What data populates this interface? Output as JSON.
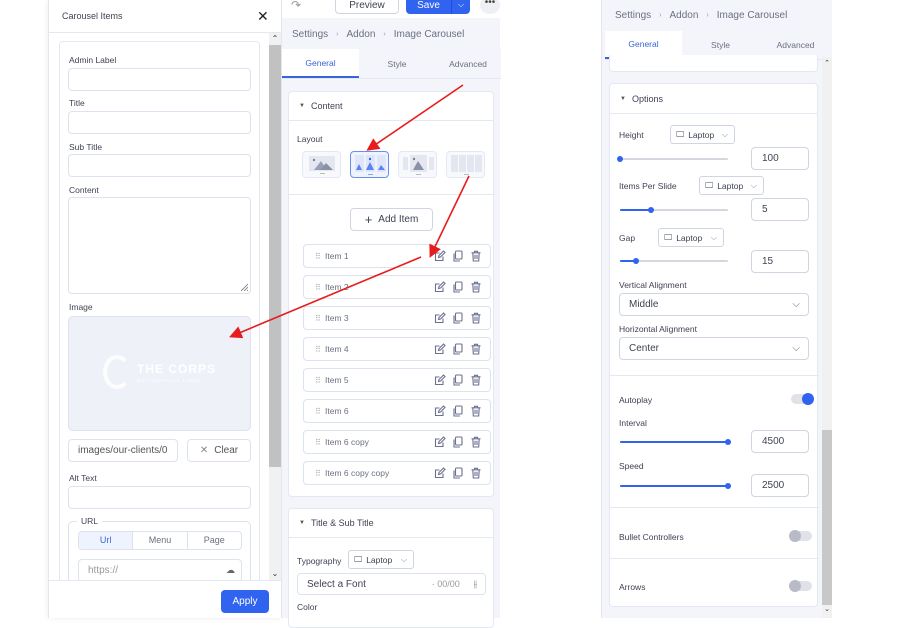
{
  "modal": {
    "title": "Carousel Items",
    "close_icon": "close-icon",
    "fields": {
      "admin_label": {
        "label": "Admin Label",
        "value": ""
      },
      "title": {
        "label": "Title",
        "value": ""
      },
      "subtitle": {
        "label": "Sub Title",
        "value": ""
      },
      "content": {
        "label": "Content",
        "value": ""
      },
      "image": {
        "label": "Image",
        "preview_logo_text": "THE CORPS",
        "preview_logo_subtext": "MULTIPURPOSE THEME",
        "path": "images/our-clients/0",
        "clear_label": "Clear"
      },
      "alt_text": {
        "label": "Alt Text",
        "value": ""
      },
      "url": {
        "legend": "URL",
        "tabs": [
          "Url",
          "Menu",
          "Page"
        ],
        "active_tab": "Url",
        "placeholder": "https://"
      }
    },
    "apply_label": "Apply"
  },
  "middle": {
    "toolbar": {
      "preview_label": "Preview",
      "save_label": "Save"
    },
    "breadcrumb": [
      "Settings",
      "Addon",
      "Image Carousel"
    ],
    "tabs": [
      "General",
      "Style",
      "Advanced"
    ],
    "active_tab": "General",
    "content_section": {
      "title": "Content",
      "layout_label": "Layout",
      "layouts": [
        "single",
        "multi-column",
        "center-focus",
        "grid"
      ],
      "selected_layout": "multi-column",
      "add_item_label": "Add Item",
      "items": [
        "Item 1",
        "Item 2",
        "Item 3",
        "Item 4",
        "Item 5",
        "Item 6",
        "Item 6 copy",
        "Item 6 copy copy"
      ]
    },
    "title_section": {
      "title": "Title & Sub Title",
      "typography_label": "Typography",
      "device": "Laptop",
      "font_placeholder": "Select a Font",
      "font_size": "00/00",
      "color_label": "Color"
    }
  },
  "right": {
    "breadcrumb": [
      "Settings",
      "Addon",
      "Image Carousel"
    ],
    "tabs": [
      "General",
      "Style",
      "Advanced"
    ],
    "active_tab": "General",
    "options": {
      "title": "Options",
      "height": {
        "label": "Height",
        "device": "Laptop",
        "value": "100",
        "slider_fraction": 0.0
      },
      "items_per_slide": {
        "label": "Items Per Slide",
        "device": "Laptop",
        "value": "5",
        "slider_fraction": 0.29
      },
      "gap": {
        "label": "Gap",
        "device": "Laptop",
        "value": "15",
        "slider_fraction": 0.15
      },
      "vertical_alignment": {
        "label": "Vertical Alignment",
        "value": "Middle"
      },
      "horizontal_alignment": {
        "label": "Horizontal Alignment",
        "value": "Center"
      },
      "autoplay": {
        "label": "Autoplay",
        "enabled": true
      },
      "interval": {
        "label": "Interval",
        "value": "4500",
        "slider_fraction": 1.0
      },
      "speed": {
        "label": "Speed",
        "value": "2500",
        "slider_fraction": 1.0
      },
      "bullet_controllers": {
        "label": "Bullet Controllers",
        "enabled": false
      },
      "arrows": {
        "label": "Arrows",
        "enabled": false
      }
    }
  },
  "colors": {
    "accent": "#2f63f0",
    "annotation_arrow": "#e81c1c"
  }
}
